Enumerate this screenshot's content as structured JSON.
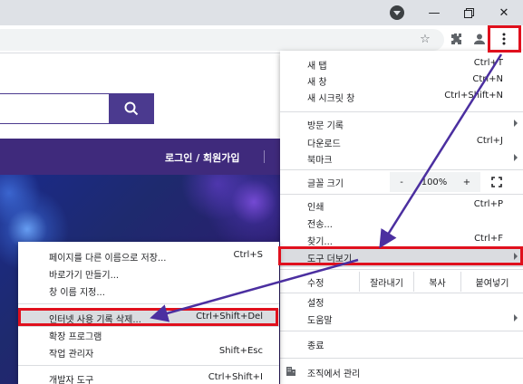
{
  "page": {
    "login_link": "로그인 / 회원가입"
  },
  "menu": {
    "items_top": [
      {
        "label": "새 탭",
        "shortcut": "Ctrl+T"
      },
      {
        "label": "새 창",
        "shortcut": "Ctrl+N"
      },
      {
        "label": "새 시크릿 창",
        "shortcut": "Ctrl+Shift+N"
      }
    ],
    "items_history": [
      {
        "label": "방문 기록",
        "shortcut": ""
      },
      {
        "label": "다운로드",
        "shortcut": "Ctrl+J"
      },
      {
        "label": "북마크",
        "shortcut": ""
      }
    ],
    "zoom": {
      "label": "글꼴 크기",
      "minus": "-",
      "value": "100%",
      "plus": "+"
    },
    "items_tools": [
      {
        "label": "인쇄",
        "shortcut": "Ctrl+P"
      },
      {
        "label": "전송...",
        "shortcut": ""
      },
      {
        "label": "찾기...",
        "shortcut": "Ctrl+F"
      },
      {
        "label": "도구 더보기",
        "shortcut": ""
      }
    ],
    "edit": {
      "label": "수정",
      "cut": "잘라내기",
      "copy": "복사",
      "paste": "붙여넣기"
    },
    "items_bottom": [
      {
        "label": "설정"
      },
      {
        "label": "도움말"
      }
    ],
    "exit": "종료",
    "managed": "조직에서 관리"
  },
  "submenu": {
    "items": [
      {
        "label": "페이지를 다른 이름으로 저장...",
        "shortcut": "Ctrl+S"
      },
      {
        "label": "바로가기 만들기...",
        "shortcut": ""
      },
      {
        "label": "창 이름 지정...",
        "shortcut": ""
      },
      {
        "label": "인터넷 사용 기록 삭제...",
        "shortcut": "Ctrl+Shift+Del"
      },
      {
        "label": "확장 프로그램",
        "shortcut": ""
      },
      {
        "label": "작업 관리자",
        "shortcut": "Shift+Esc"
      },
      {
        "label": "개발자 도구",
        "shortcut": "Ctrl+Shift+I"
      }
    ]
  },
  "colors": {
    "highlight_red": "#e0101d",
    "arrow_purple": "#4b2fa0",
    "site_purple": "#3f2a7c"
  }
}
